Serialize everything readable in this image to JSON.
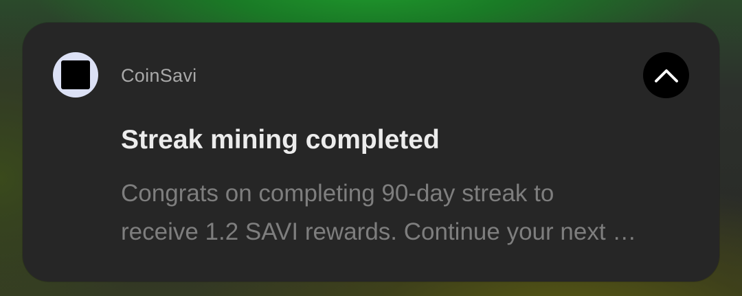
{
  "notification": {
    "app_name": "CoinSavi",
    "app_icon": "coinsavi-app-icon",
    "action_icon": "chevron-up-icon",
    "title": "Streak mining completed",
    "body_line_1": "Congrats on completing 90-day streak to",
    "body_line_2": "receive 1.2 SAVI rewards. Continue your next …"
  },
  "colors": {
    "card_background": "#262626",
    "title": "#ececec",
    "body": "#7e7e7e",
    "app_name": "#a9a9a9",
    "avatar_background": "#dce1f5",
    "collapse_button": "#000000"
  }
}
